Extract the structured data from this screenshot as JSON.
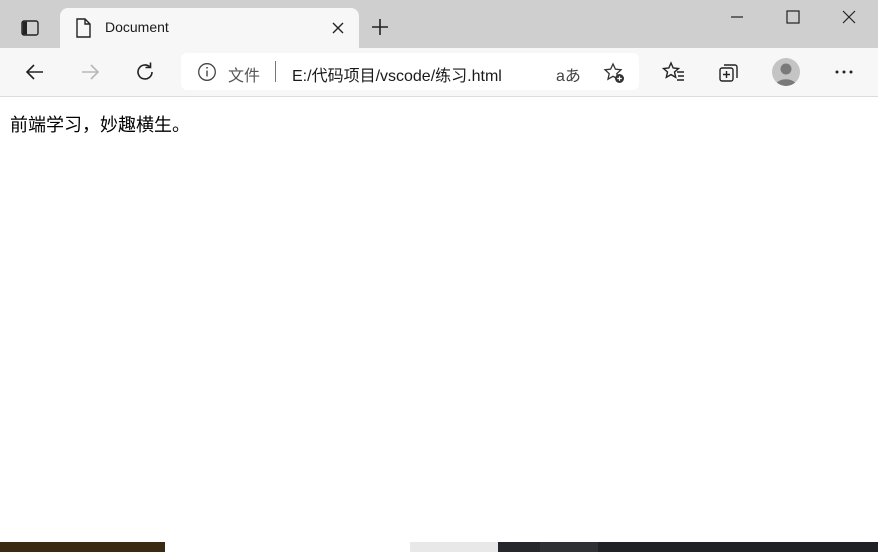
{
  "tab": {
    "title": "Document"
  },
  "address_bar": {
    "site_label": "文件",
    "url": "E:/代码项目/vscode/练习.html",
    "read_aloud_label": "aあ"
  },
  "page": {
    "text": "前端学习，妙趣横生。"
  },
  "icons": {
    "tab_actions": "tab-actions-icon",
    "document": "document-icon",
    "close": "close-icon",
    "new_tab": "plus-icon",
    "minimize": "minimize-icon",
    "maximize": "maximize-icon",
    "window_close": "window-close-icon",
    "back": "back-arrow-icon",
    "forward": "forward-arrow-icon",
    "refresh": "refresh-icon",
    "info": "info-icon",
    "add_favorite": "star-add-icon",
    "favorites": "favorites-icon",
    "collections": "collections-icon",
    "profile": "profile-avatar",
    "more": "more-icon"
  }
}
